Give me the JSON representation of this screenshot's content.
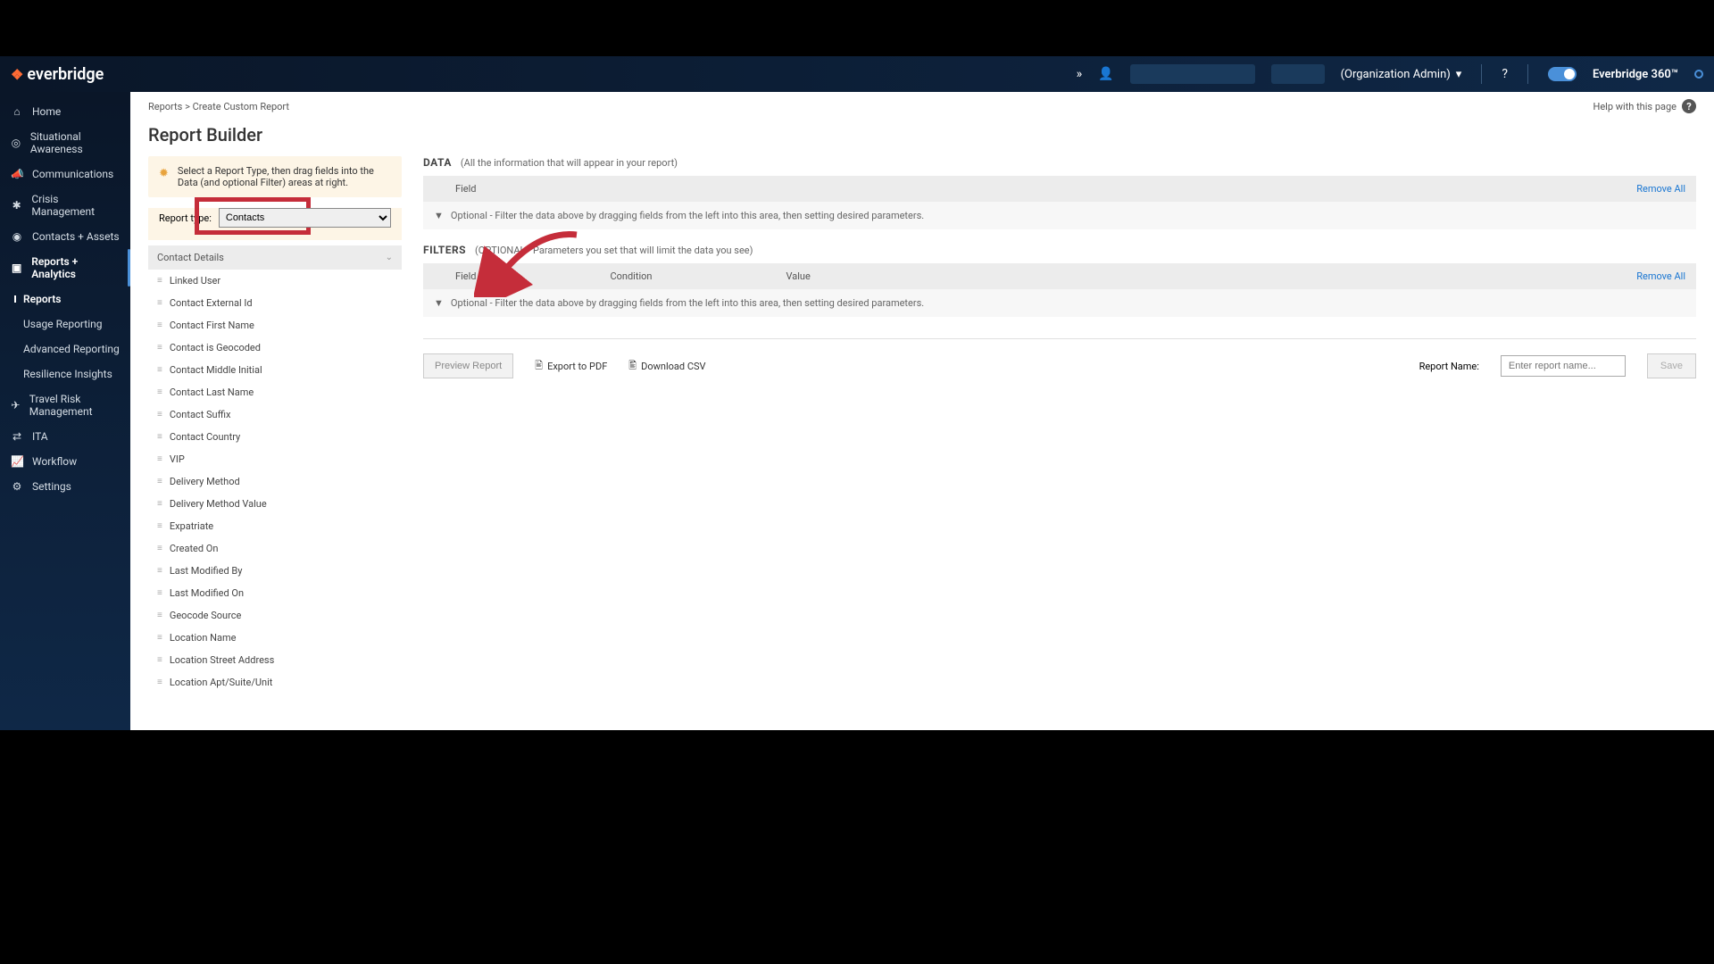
{
  "topbar": {
    "brand": "everbridge",
    "org_role": "(Organization Admin)",
    "product": "Everbridge 360™"
  },
  "sidebar": {
    "items": [
      {
        "label": "Home",
        "icon": "⌂"
      },
      {
        "label": "Situational Awareness",
        "icon": "◎"
      },
      {
        "label": "Communications",
        "icon": "📣"
      },
      {
        "label": "Crisis Management",
        "icon": "✱"
      },
      {
        "label": "Contacts + Assets",
        "icon": "◉"
      },
      {
        "label": "Reports + Analytics",
        "icon": "▣"
      }
    ],
    "sub": [
      {
        "label": "Reports"
      },
      {
        "label": "Usage Reporting"
      },
      {
        "label": "Advanced Reporting"
      },
      {
        "label": "Resilience Insights"
      }
    ],
    "items2": [
      {
        "label": "Travel Risk Management",
        "icon": "✈"
      },
      {
        "label": "ITA",
        "icon": "⇄"
      },
      {
        "label": "Workflow",
        "icon": "📈"
      },
      {
        "label": "Settings",
        "icon": "⚙"
      }
    ]
  },
  "breadcrumb": {
    "root": "Reports",
    "current": "Create Custom Report"
  },
  "help": {
    "label": "Help with this page"
  },
  "page_title": "Report Builder",
  "hint": "Select a Report Type, then drag fields into the Data (and optional Filter) areas at right.",
  "report_type": {
    "label": "Report type:",
    "value": "Contacts"
  },
  "field_group": "Contact Details",
  "fields": [
    "Linked User",
    "Contact External Id",
    "Contact First Name",
    "Contact is Geocoded",
    "Contact Middle Initial",
    "Contact Last Name",
    "Contact Suffix",
    "Contact Country",
    "VIP",
    "Delivery Method",
    "Delivery Method Value",
    "Expatriate",
    "Created On",
    "Last Modified By",
    "Last Modified On",
    "Geocode Source",
    "Location Name",
    "Location Street Address",
    "Location Apt/Suite/Unit"
  ],
  "data_section": {
    "title": "DATA",
    "subtitle": "(All the information that will appear in your report)",
    "col_field": "Field",
    "remove_all": "Remove All",
    "drop_hint": "Optional - Filter the data above by dragging fields from the left into this area, then setting desired parameters."
  },
  "filters_section": {
    "title": "FILTERS",
    "subtitle": "(OPTIONAL - Parameters you set that will limit the data you see)",
    "col_field": "Field",
    "col_cond": "Condition",
    "col_value": "Value",
    "remove_all": "Remove All",
    "drop_hint": "Optional - Filter the data above by dragging fields from the left into this area, then setting desired parameters."
  },
  "actions": {
    "preview": "Preview Report",
    "export_pdf": "Export to PDF",
    "download_csv": "Download CSV",
    "name_label": "Report Name:",
    "name_placeholder": "Enter report name...",
    "save": "Save"
  }
}
